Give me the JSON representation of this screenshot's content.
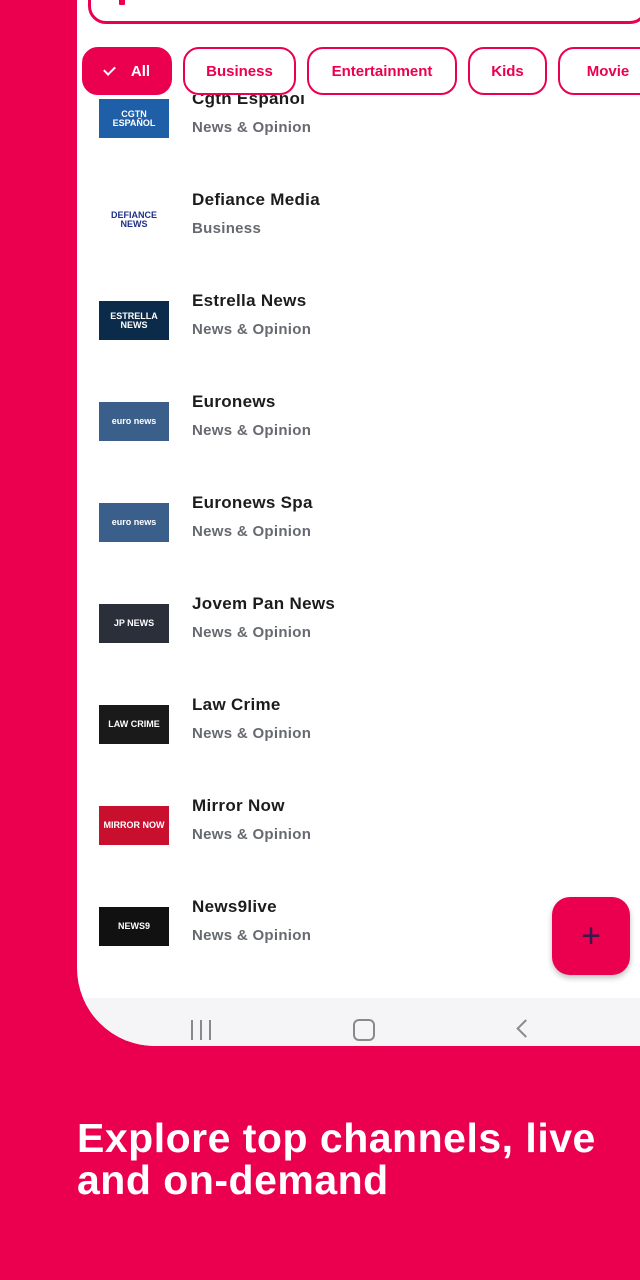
{
  "filters": [
    {
      "label": "All",
      "active": true
    },
    {
      "label": "Business",
      "active": false
    },
    {
      "label": "Entertainment",
      "active": false
    },
    {
      "label": "Kids",
      "active": false
    },
    {
      "label": "Movie",
      "active": false
    }
  ],
  "channels": [
    {
      "name": "Cgtn Espanol",
      "category": "News & Opinion",
      "logo_text": "CGTN ESPAÑOL",
      "logo_bg": "#1f5fa8"
    },
    {
      "name": "Defiance Media",
      "category": "Business",
      "logo_text": "DEFIANCE NEWS",
      "logo_bg": "#ffffff"
    },
    {
      "name": "Estrella News",
      "category": "News & Opinion",
      "logo_text": "ESTRELLA NEWS",
      "logo_bg": "#0c2b4a"
    },
    {
      "name": "Euronews",
      "category": "News & Opinion",
      "logo_text": "euro news",
      "logo_bg": "#3a5f8a"
    },
    {
      "name": "Euronews Spa",
      "category": "News & Opinion",
      "logo_text": "euro news",
      "logo_bg": "#3a5f8a"
    },
    {
      "name": "Jovem Pan News",
      "category": "News & Opinion",
      "logo_text": "JP NEWS",
      "logo_bg": "#2a2f3a"
    },
    {
      "name": "Law Crime",
      "category": "News & Opinion",
      "logo_text": "LAW CRIME",
      "logo_bg": "#1a1a1a"
    },
    {
      "name": "Mirror Now",
      "category": "News & Opinion",
      "logo_text": "MIRROR NOW",
      "logo_bg": "#c8102e"
    },
    {
      "name": "News9live",
      "category": "News & Opinion",
      "logo_text": "NEWS9",
      "logo_bg": "#111111"
    }
  ],
  "fab_icon": "plus-icon",
  "fab_symbol": "+",
  "navigation": {
    "recent": "recent-apps-icon",
    "home": "home-icon",
    "back": "back-icon"
  },
  "headline": "Explore top channels, live and on-demand",
  "colors": {
    "brand": "#EA004F",
    "title_text": "#1c1c1c",
    "subtitle_text": "#666a70"
  }
}
